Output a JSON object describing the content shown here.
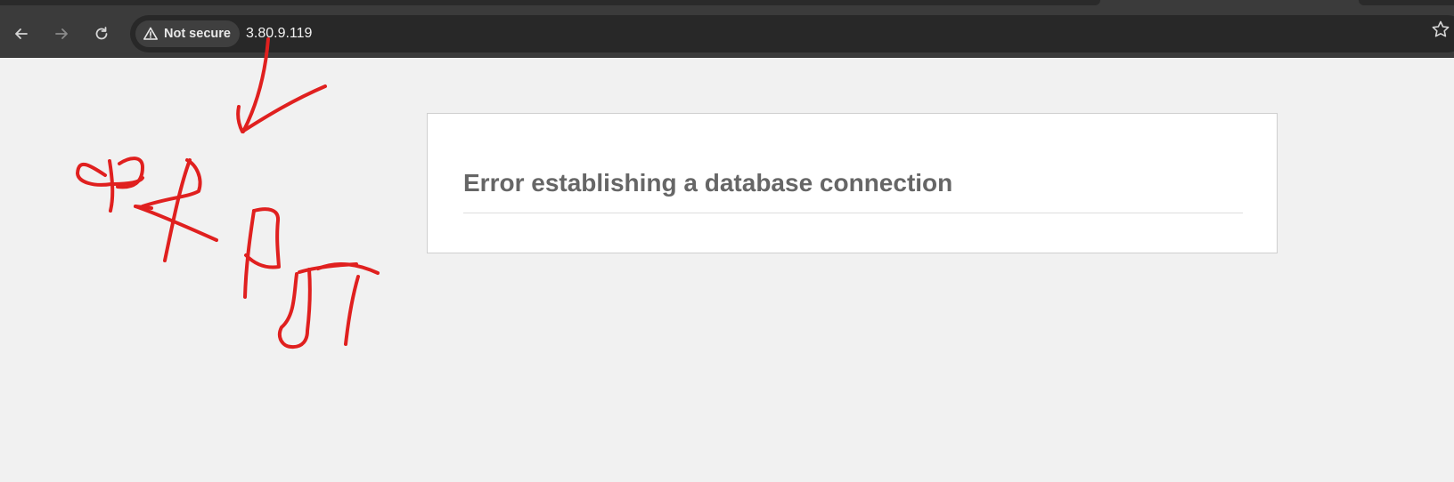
{
  "browser": {
    "back_icon": "arrow-left-icon",
    "forward_icon": "arrow-right-icon",
    "reload_icon": "reload-icon",
    "security_chip": {
      "icon": "warning-triangle-icon",
      "label": "Not secure"
    },
    "url": "3.80.9.119",
    "bookmark_icon": "star-icon"
  },
  "page": {
    "error_title": "Error establishing a database connection"
  },
  "colors": {
    "annotation": "#e0201f",
    "page_background": "#f1f1f1",
    "toolbar": "#3b3b3b",
    "omnibox": "#282828",
    "error_text": "#666666"
  }
}
